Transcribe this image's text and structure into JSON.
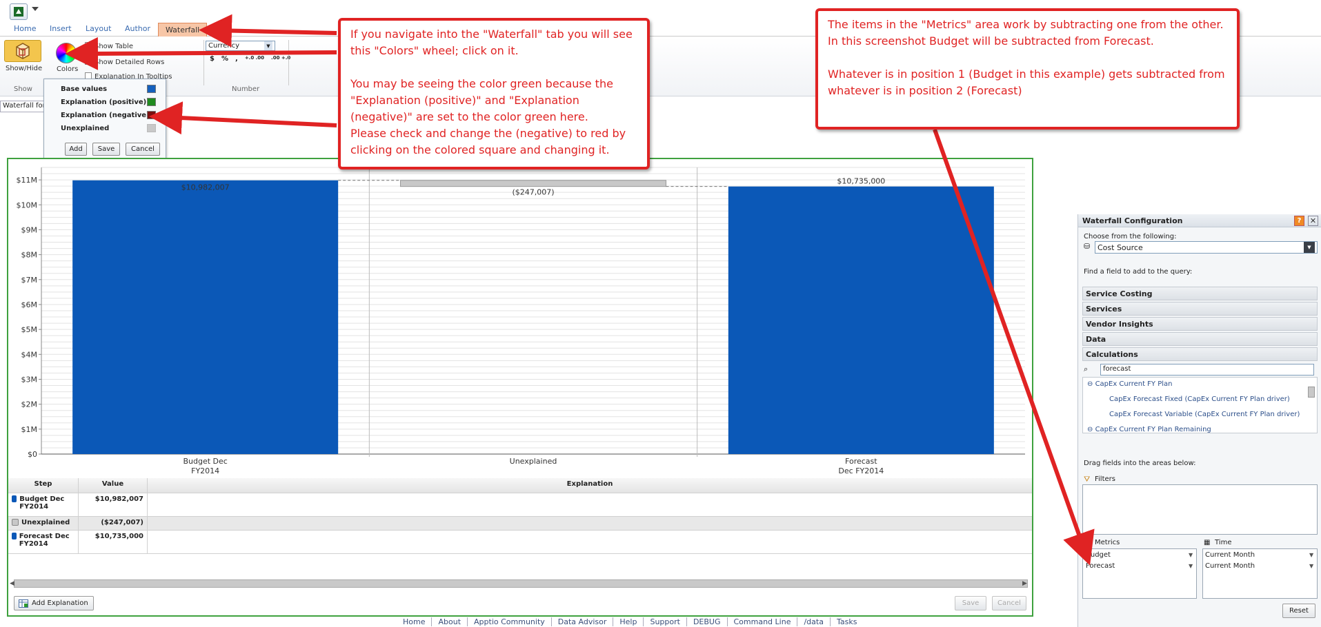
{
  "ribbon": {
    "tabs": [
      "Home",
      "Insert",
      "Layout",
      "Author",
      "Waterfall"
    ],
    "show_hide_label": "Show/Hide",
    "colors_label": "Colors",
    "show_table": "Show Table",
    "show_detailed_rows": "Show Detailed Rows",
    "explanation_in_tooltips": "Explanation In Tooltips",
    "currency_select": "Currency",
    "number_format_symbols": [
      "$",
      "%",
      ",",
      "+.0 .00",
      ".00 +.0"
    ],
    "group_show": "Show",
    "group_number": "Number"
  },
  "colors_popup": {
    "rows": [
      {
        "label": "Base values",
        "color": "#1560bd"
      },
      {
        "label": "Explanation (positive)",
        "color": "#1f8a1f"
      },
      {
        "label": "Explanation (negative)",
        "color": "#7a0f0f"
      },
      {
        "label": "Unexplained",
        "color": "#c8c8c8"
      }
    ],
    "add": "Add",
    "save": "Save",
    "cancel": "Cancel"
  },
  "report_title_input": "Waterfall for Ti",
  "callouts": {
    "left": "If you navigate into the \"Waterfall\" tab you will see this \"Colors\" wheel; click on it.\n\nYou may be seeing the color green because the \"Explanation (positive)\" and \"Explanation (negative)\" are set to the color green here.\nPlease check and change the (negative) to red by clicking on the colored square and changing it.",
    "right": "The items in the \"Metrics\" area work by subtracting one from the other. In this screenshot Budget will be subtracted from Forecast.\n\nWhatever is in position 1 (Budget in this example) gets subtracted from whatever is in position 2 (Forecast)"
  },
  "chart_data": {
    "type": "bar",
    "subtype": "waterfall",
    "categories": [
      "Budget Dec FY2014",
      "Unexplained",
      "Forecast Dec FY2014"
    ],
    "category_labels": [
      [
        "Budget Dec",
        "FY2014"
      ],
      [
        "Unexplained"
      ],
      [
        "Forecast",
        "Dec FY2014"
      ]
    ],
    "values": [
      10982007,
      -247007,
      10735000
    ],
    "data_labels": [
      "$10,982,007",
      "($247,007)",
      "$10,735,000"
    ],
    "colors": [
      "#0b58b7",
      "#c8c8c8",
      "#0b58b7"
    ],
    "yticks": [
      "$0",
      "$1M",
      "$2M",
      "$3M",
      "$4M",
      "$5M",
      "$6M",
      "$7M",
      "$8M",
      "$9M",
      "$10M",
      "$11M"
    ],
    "ylim": [
      0,
      11500000
    ],
    "grid": true
  },
  "table": {
    "headers": [
      "Step",
      "Value",
      "Explanation"
    ],
    "rows": [
      {
        "step": "Budget Dec FY2014",
        "value": "$10,982,007",
        "explanation": "",
        "color": "#0b58b7"
      },
      {
        "step": "Unexplained",
        "value": "($247,007)",
        "explanation": "",
        "color": "#c8c8c8"
      },
      {
        "step": "Forecast Dec FY2014",
        "value": "$10,735,000",
        "explanation": "",
        "color": "#0b58b7"
      }
    ]
  },
  "bottom_buttons": {
    "add_explanation": "Add Explanation",
    "save": "Save",
    "cancel": "Cancel"
  },
  "config": {
    "title": "Waterfall Configuration",
    "choose_label": "Choose from the following:",
    "choose_value": "Cost Source",
    "find_label": "Find a field to add to the query:",
    "categories": [
      "Service Costing",
      "Services",
      "Vendor Insights",
      "Data",
      "Calculations"
    ],
    "search_value": "forecast",
    "tree": [
      {
        "label": "CapEx Current FY Plan",
        "level": 0
      },
      {
        "label": "CapEx Forecast Fixed (CapEx Current FY Plan driver)",
        "level": 1
      },
      {
        "label": "CapEx Forecast Variable (CapEx Current FY Plan driver)",
        "level": 1
      },
      {
        "label": "CapEx Current FY Plan Remaining",
        "level": 0
      }
    ],
    "drag_label": "Drag fields into the areas below:",
    "filters_label": "Filters",
    "metrics_label": "Metrics",
    "metrics": [
      "Budget",
      "Forecast"
    ],
    "time_label": "Time",
    "time": [
      "Current Month",
      "Current Month"
    ],
    "reset": "Reset"
  },
  "footer": [
    "Home",
    "About",
    "Apptio Community",
    "Data Advisor",
    "Help",
    "Support",
    "DEBUG",
    "Command Line",
    "/data",
    "Tasks"
  ]
}
